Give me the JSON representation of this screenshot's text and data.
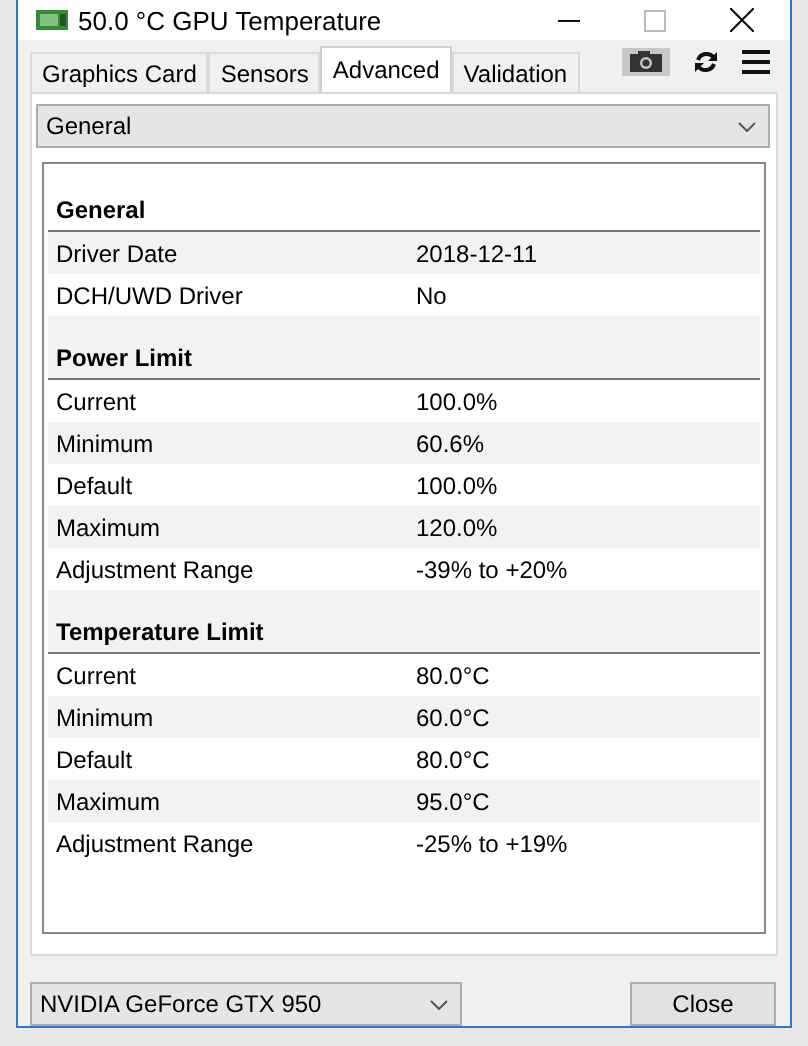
{
  "window": {
    "title": "50.0 °C GPU Temperature"
  },
  "tabs": [
    {
      "label": "Graphics Card",
      "selected": false
    },
    {
      "label": "Sensors",
      "selected": false
    },
    {
      "label": "Advanced",
      "selected": true
    },
    {
      "label": "Validation",
      "selected": false
    }
  ],
  "category_select": {
    "value": "General"
  },
  "sections": [
    {
      "title": "General",
      "rows": [
        {
          "label": "Driver Date",
          "value": "2018-12-11"
        },
        {
          "label": "DCH/UWD Driver",
          "value": "No"
        }
      ]
    },
    {
      "title": "Power Limit",
      "rows": [
        {
          "label": "Current",
          "value": "100.0%"
        },
        {
          "label": "Minimum",
          "value": "60.6%"
        },
        {
          "label": "Default",
          "value": "100.0%"
        },
        {
          "label": "Maximum",
          "value": "120.0%"
        },
        {
          "label": "Adjustment Range",
          "value": "-39% to +20%"
        }
      ]
    },
    {
      "title": "Temperature Limit",
      "rows": [
        {
          "label": "Current",
          "value": "80.0°C"
        },
        {
          "label": "Minimum",
          "value": "60.0°C"
        },
        {
          "label": "Default",
          "value": "80.0°C"
        },
        {
          "label": "Maximum",
          "value": "95.0°C"
        },
        {
          "label": "Adjustment Range",
          "value": "-25% to +19%"
        }
      ]
    }
  ],
  "gpu_select": {
    "value": "NVIDIA GeForce GTX 950"
  },
  "close_button": {
    "label": "Close"
  }
}
